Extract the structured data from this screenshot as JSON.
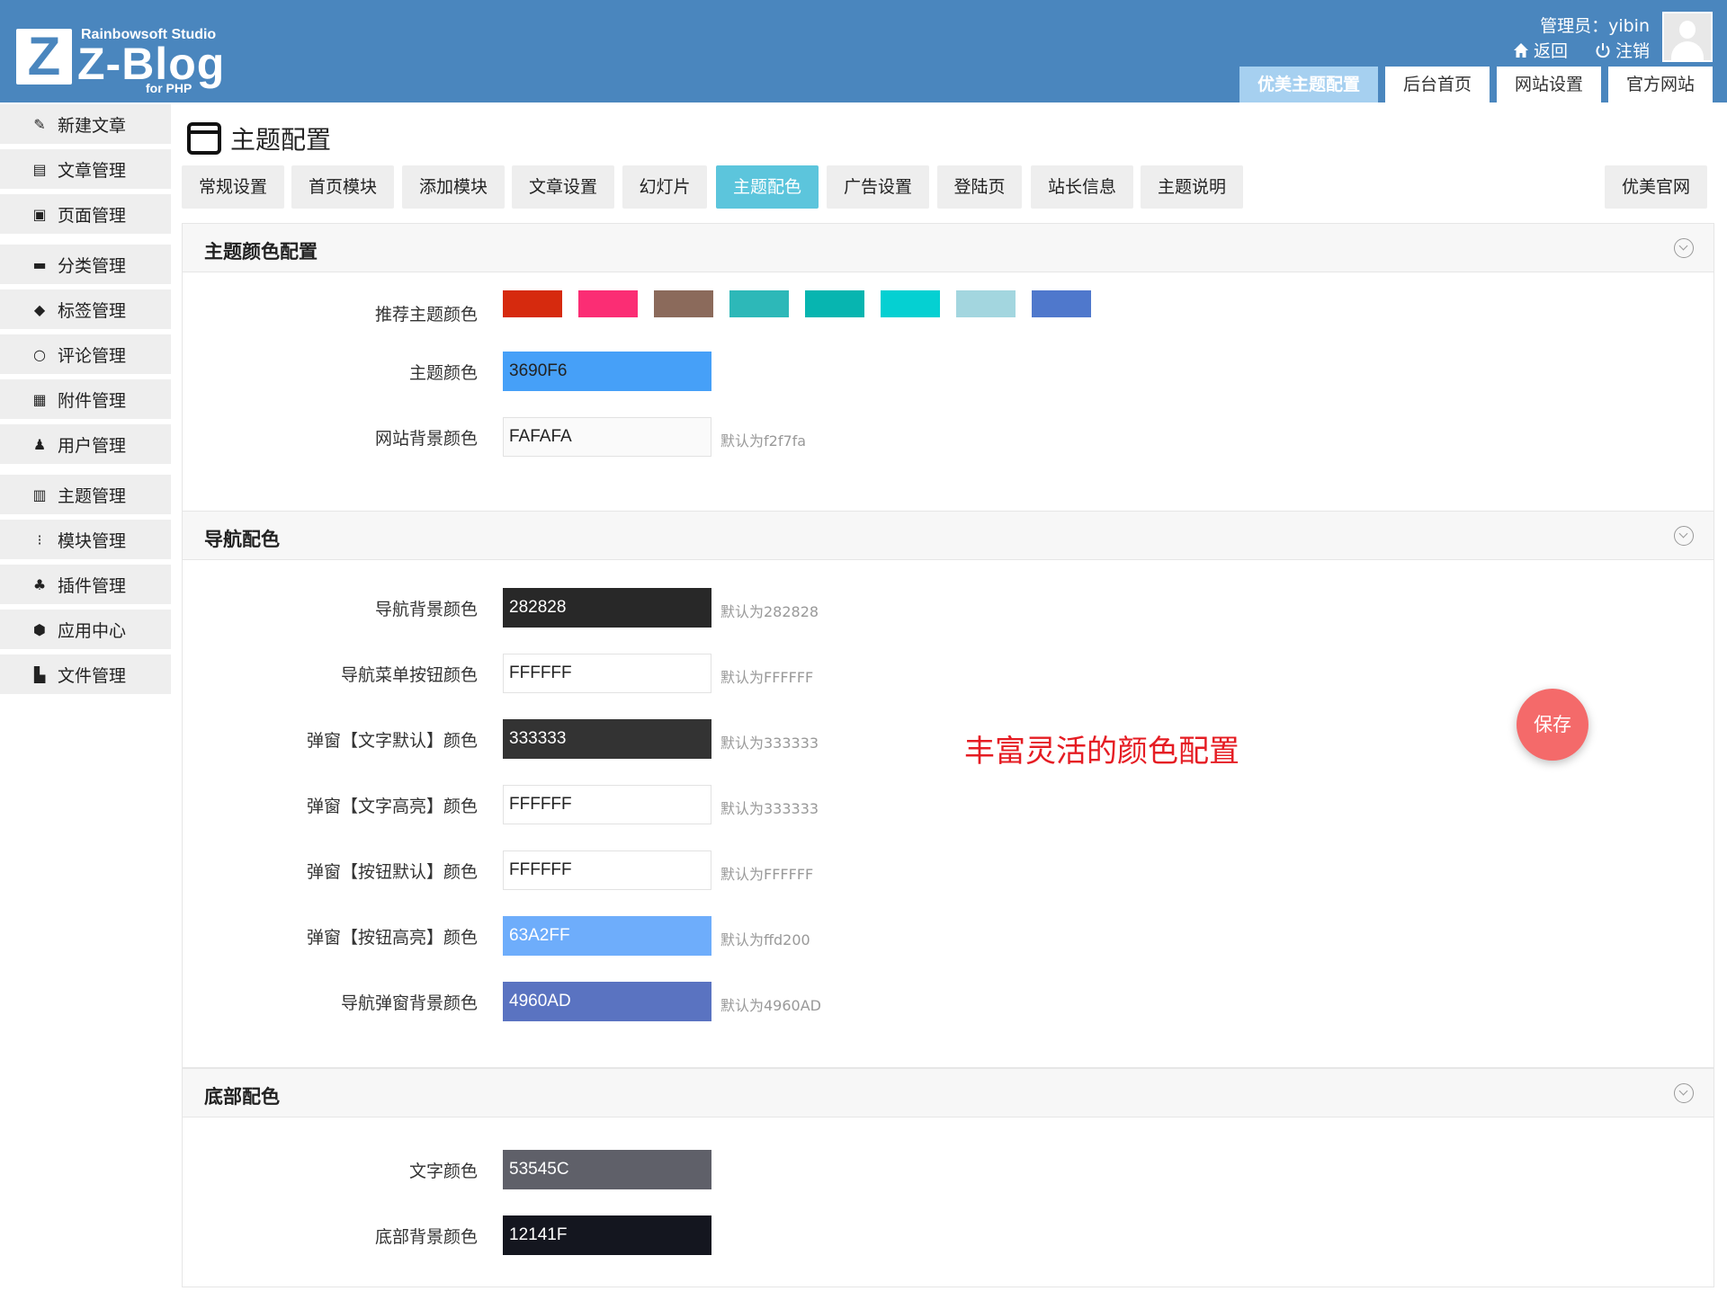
{
  "logo": {
    "studio": "Rainbowsoft Studio",
    "name": "Z-Blog",
    "sub": "for PHP",
    "mark": "Z"
  },
  "header": {
    "admin": "管理员：yibin",
    "back": "返回",
    "logout": "注销",
    "nav": [
      "优美主题配置",
      "后台首页",
      "网站设置",
      "官方网站"
    ]
  },
  "sidebar": {
    "items": [
      {
        "label": "新建文章",
        "icon": "edit-icon"
      },
      {
        "label": "文章管理",
        "icon": "article-icon"
      },
      {
        "label": "页面管理",
        "icon": "page-icon"
      },
      {
        "label": "分类管理",
        "icon": "folder-icon"
      },
      {
        "label": "标签管理",
        "icon": "tag-icon"
      },
      {
        "label": "评论管理",
        "icon": "comment-icon"
      },
      {
        "label": "附件管理",
        "icon": "attachment-icon"
      },
      {
        "label": "用户管理",
        "icon": "user-icon"
      },
      {
        "label": "主题管理",
        "icon": "theme-icon"
      },
      {
        "label": "模块管理",
        "icon": "module-icon"
      },
      {
        "label": "插件管理",
        "icon": "plugin-icon"
      },
      {
        "label": "应用中心",
        "icon": "app-icon"
      },
      {
        "label": "文件管理",
        "icon": "file-icon"
      }
    ]
  },
  "page": {
    "title": "主题配置",
    "tabs": [
      "常规设置",
      "首页模块",
      "添加模块",
      "文章设置",
      "幻灯片",
      "主题配色",
      "广告设置",
      "登陆页",
      "站长信息",
      "主题说明"
    ],
    "tab_right": "优美官网",
    "active_tab": "主题配色"
  },
  "theme_panel": {
    "title": "主题颜色配置",
    "recommend_label": "推荐主题颜色",
    "swatches": [
      "#d62a0e",
      "#fb2d74",
      "#8b6a5b",
      "#2db8b8",
      "#07b5b0",
      "#05d0d2",
      "#a3d6df",
      "#4f78cc"
    ],
    "main_color": {
      "label": "主题颜色",
      "value": "3690F6",
      "bg": "#46a0f8"
    },
    "site_bg": {
      "label": "网站背景颜色",
      "value": "FAFAFA",
      "hint": "默认为f2f7fa"
    }
  },
  "nav_panel": {
    "title": "导航配色",
    "rows": [
      {
        "label": "导航背景颜色",
        "value": "282828",
        "hint": "默认为282828",
        "bg": "#282828",
        "dark": true
      },
      {
        "label": "导航菜单按钮颜色",
        "value": "FFFFFF",
        "hint": "默认为FFFFFF",
        "bg": "#ffffff",
        "dark": false
      },
      {
        "label": "弹窗【文字默认】颜色",
        "value": "333333",
        "hint": "默认为333333",
        "bg": "#333333",
        "dark": true
      },
      {
        "label": "弹窗【文字高亮】颜色",
        "value": "FFFFFF",
        "hint": "默认为333333",
        "bg": "#ffffff",
        "dark": false
      },
      {
        "label": "弹窗【按钮默认】颜色",
        "value": "FFFFFF",
        "hint": "默认为FFFFFF",
        "bg": "#ffffff",
        "dark": false
      },
      {
        "label": "弹窗【按钮高亮】颜色",
        "value": "63A2FF",
        "hint": "默认为ffd200",
        "bg": "#6eadfb",
        "dark": true
      },
      {
        "label": "导航弹窗背景颜色",
        "value": "4960AD",
        "hint": "默认为4960AD",
        "bg": "#5a73c1",
        "dark": true
      }
    ]
  },
  "footer_panel": {
    "title": "底部配色",
    "rows": [
      {
        "label": "文字颜色",
        "value": "53545C",
        "bg": "#5f6069",
        "dark": true
      },
      {
        "label": "底部背景颜色",
        "value": "12141F",
        "bg": "#14161f",
        "dark": true
      }
    ]
  },
  "promo": "丰富灵活的颜色配置",
  "save_label": "保存"
}
